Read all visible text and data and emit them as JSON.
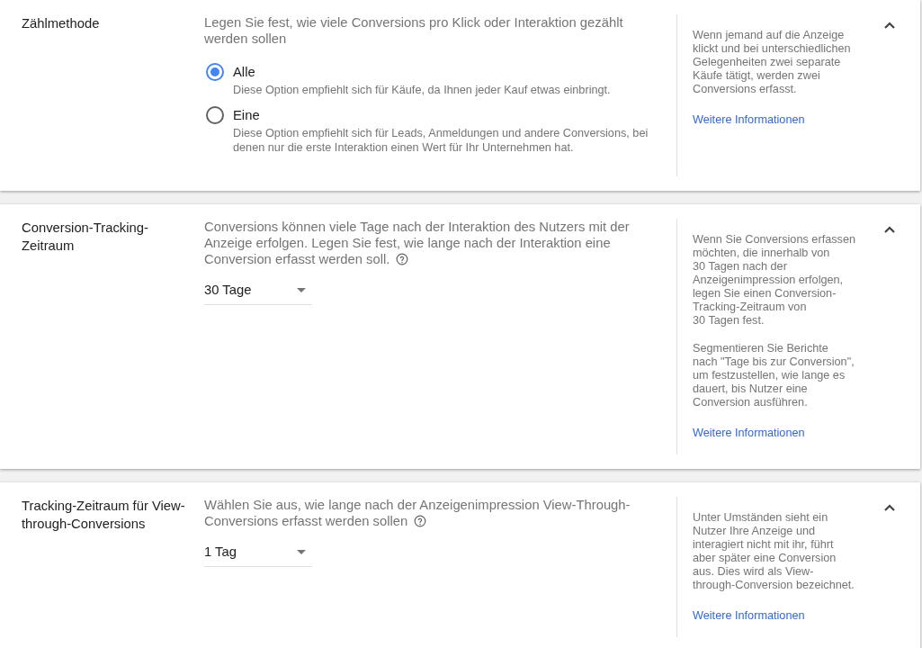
{
  "sections": [
    {
      "title": "Zählmethode",
      "expanded": true,
      "description_lines": [
        "Legen Sie fest, wie viele Conversions pro Klick oder Interaktion gezählt",
        "werden sollen"
      ],
      "help_icon": false,
      "control": {
        "kind": "radio",
        "options": [
          {
            "label": "Alle",
            "selected": true,
            "description": "Diese Option empfiehlt sich für Käufe, da Ihnen jeder Kauf etwas einbringt."
          },
          {
            "label": "Eine",
            "selected": false,
            "description": "Diese Option empfiehlt sich für Leads, Anmeldungen und andere Conversions, bei\ndenen nur die erste Interaktion einen Wert für Ihr Unternehmen hat."
          }
        ]
      },
      "help": {
        "paragraphs": [
          "Wenn jemand auf die Anzeige\nklickt und bei unterschiedlichen\nGelegenheiten zwei separate\nKäufe tätigt, werden zwei\nConversions erfasst."
        ],
        "link": "Weitere Informationen"
      }
    },
    {
      "title": "Conversion-Tracking-\nZeitraum",
      "expanded": true,
      "description_lines": [
        "Conversions können viele Tage nach der Interaktion des Nutzers mit der",
        "Anzeige erfolgen. Legen Sie fest, wie lange nach der Interaktion eine",
        "Conversion erfasst werden soll."
      ],
      "help_icon": true,
      "control": {
        "kind": "dropdown",
        "value": "30 Tage"
      },
      "help": {
        "paragraphs": [
          "Wenn Sie Conversions erfassen\nmöchten, die innerhalb von\n30 Tagen nach der\nAnzeigenimpression erfolgen,\nlegen Sie einen Conversion-\nTracking-Zeitraum von\n30 Tagen fest.",
          "Segmentieren Sie Berichte\nnach \"Tage bis zur Conversion\",\num festzustellen, wie lange es\ndauert, bis Nutzer eine\nConversion ausführen."
        ],
        "link": "Weitere Informationen"
      }
    },
    {
      "title": "Tracking-Zeitraum für View-\nthrough-Conversions",
      "expanded": true,
      "description_lines": [
        "Wählen Sie aus, wie lange nach der Anzeigenimpression View-Through-",
        "Conversions erfasst werden sollen"
      ],
      "help_icon": true,
      "control": {
        "kind": "dropdown",
        "value": "1 Tag"
      },
      "help": {
        "paragraphs": [
          "Unter Umständen sieht ein\nNutzer Ihre Anzeige und\ninteragiert nicht mit ihr, führt\naber später eine Conversion\naus. Dies wird als View-\nthrough-Conversion bezeichnet."
        ],
        "link": "Weitere Informationen"
      }
    }
  ]
}
